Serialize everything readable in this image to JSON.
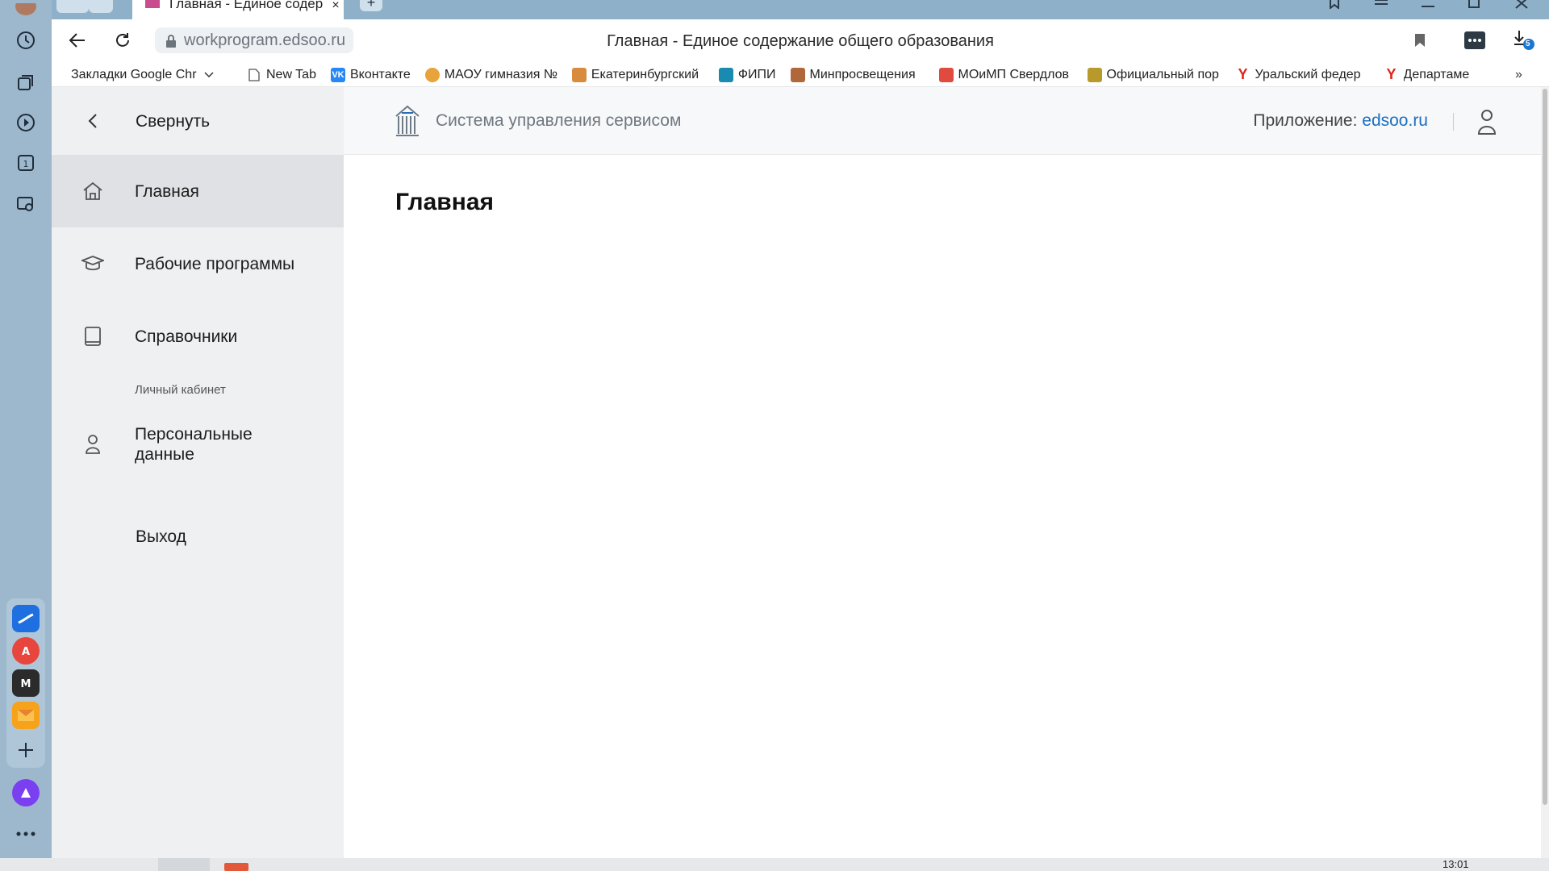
{
  "tab": {
    "title": "Главная - Единое содер",
    "close": "×"
  },
  "address": {
    "url": "workprogram.edsoo.ru",
    "page_title": "Главная - Единое содержание общего образования",
    "downloads_badge": "5"
  },
  "bookmarks": [
    {
      "label": "Закладки Google Chr",
      "icon": "folder-icon",
      "color": ""
    },
    {
      "label": "New Tab",
      "icon": "page-icon",
      "color": ""
    },
    {
      "label": "Вконтакте",
      "icon": "vk-icon",
      "color": "#2787f5"
    },
    {
      "label": "МАОУ гимназия №",
      "icon": "school-icon",
      "color": "#e8a33b"
    },
    {
      "label": "Екатеринбургский",
      "icon": "city-icon",
      "color": "#d88a3d"
    },
    {
      "label": "ФИПИ",
      "icon": "fipi-icon",
      "color": "#1a8bb0"
    },
    {
      "label": "Минпросвещения",
      "icon": "eagle-icon",
      "color": "#b0673a"
    },
    {
      "label": "МОиМП Свердлов",
      "icon": "tiles-icon",
      "color": "#e04a3f"
    },
    {
      "label": "Официальный пор",
      "icon": "crest-icon",
      "color": "#b89a2c"
    },
    {
      "label": "Уральский федер",
      "icon": "yandex-icon",
      "color": "#e2231a"
    },
    {
      "label": "Департаме",
      "icon": "yandex-icon",
      "color": "#e2231a"
    }
  ],
  "sidebar": {
    "collapse_label": "Свернуть",
    "items": [
      {
        "label": "Главная",
        "icon": "home-icon",
        "active": true
      },
      {
        "label": "Рабочие программы",
        "icon": "graduation-cap-icon",
        "active": false
      },
      {
        "label": "Справочники",
        "icon": "book-icon",
        "active": false
      }
    ],
    "section_title": "Личный кабинет",
    "personal": {
      "label": "Персональные данные",
      "icon": "user-icon"
    },
    "logout": "Выход"
  },
  "header": {
    "system_name": "Система управления сервисом",
    "app_label": "Приложение:",
    "app_link": "edsoo.ru"
  },
  "main": {
    "title": "Главная"
  },
  "taskbar": {
    "clock": "13:01"
  },
  "colors": {
    "accent": "#1a6fc0",
    "rail": "#9db8cc",
    "drawer": "#eef0f2",
    "active_item": "#dfe1e4"
  }
}
